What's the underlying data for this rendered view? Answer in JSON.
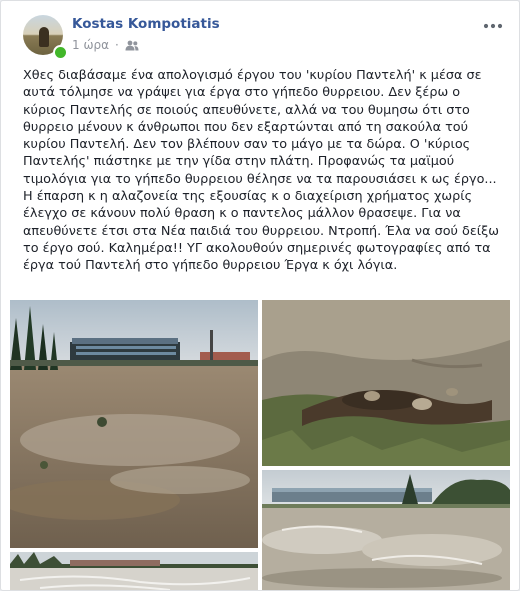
{
  "post": {
    "author": "Kostas Kompotiatis",
    "time": "1 ώρα",
    "audience_icon": "friends-icon",
    "more_icon": "more-options-icon",
    "text": "Χθες διαβάσαμε ένα απολογισμό έργου του 'κυρίου Παντελή' κ μέσα σε αυτά τόλμησε να γράψει για έργα στο γήπεδο θυρρειου. Δεν ξέρω ο κύριος Παντελής σε ποιούς απευθύνετε, αλλά να του θυμησω ότι στο θυρρειο μένουν κ άνθρωποι που δεν εξαρτώνται από τη σακούλα τού κυρίου Παντελή. Δεν τον βλέπουν σαν το μάγο με τα δώρα. Ο 'κύριος Παντελής' πιάστηκε με την γίδα στην πλάτη. Προφανώς τα μαϊμού τιμολόγια για το γήπεδο θυρρειου θέλησε να τα παρουσιάσει κ ως έργο... Η έπαρση κ η αλαζονεία της εξουσίας κ ο διαχείριση χρήματος χωρίς έλεγχο σε κάνουν πολύ θραση κ ο παντελος μάλλον θρασεψε. Για να απευθύνετε έτσι στα Νέα παιδιά του θυρρειου. Ντροπή. Έλα να σού δείξω το έργο σού. Καλημέρα!! ΥΓ ακολουθούν σημερινές φωτογραφίες από τα έργα τού Παντελή στο γήπεδο θυρρειου Έργα κ όχι λόγια."
  },
  "colors": {
    "author": "#365899",
    "meta": "#90949c",
    "online": "#42b72a",
    "card_border": "#dddfe2",
    "page_bg": "#e9ebee"
  }
}
